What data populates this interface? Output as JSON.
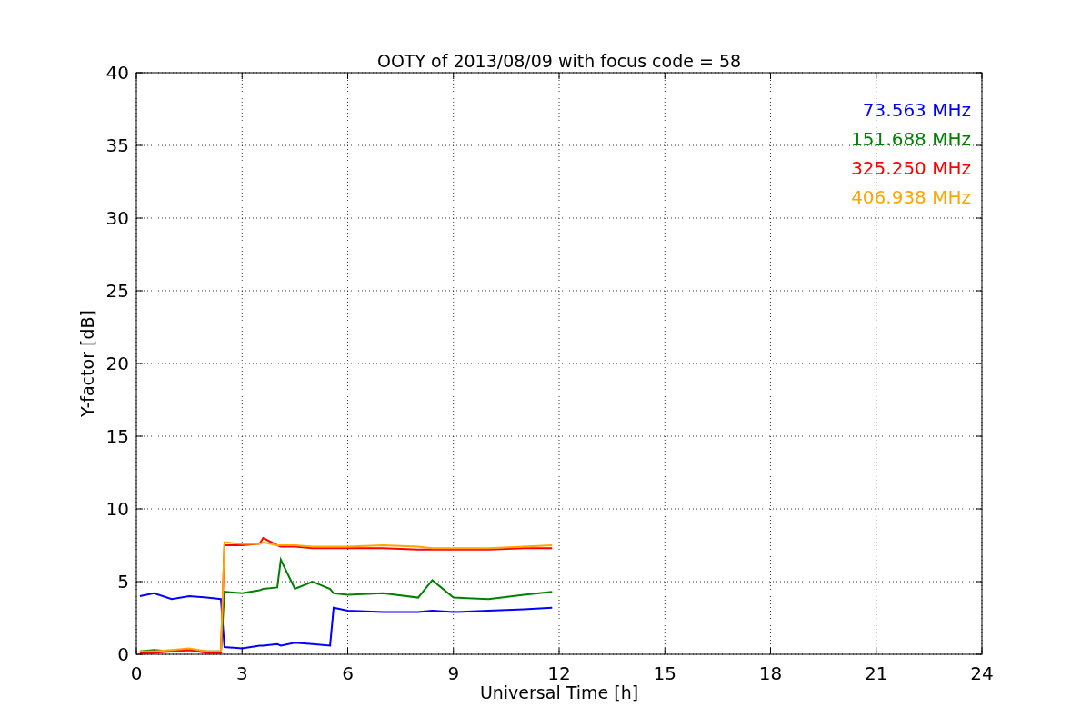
{
  "figure": {
    "chart_data": {
      "type": "line",
      "title": "OOTY of 2013/08/09 with focus code = 58",
      "xlabel": "Universal Time [h]",
      "ylabel": "Y-factor [dB]",
      "x": [
        0.1,
        0.5,
        1,
        1.5,
        2,
        2.4,
        2.5,
        3,
        3.5,
        3.6,
        4,
        4.1,
        4.5,
        5,
        5.5,
        5.6,
        6,
        7,
        8,
        8.4,
        9,
        10,
        11,
        11.8
      ],
      "series": [
        {
          "name": "73.563 MHz",
          "color": "#0000ff",
          "values": [
            4,
            4.2,
            3.8,
            4,
            3.9,
            3.8,
            0.5,
            0.4,
            0.6,
            0.6,
            0.7,
            0.6,
            0.8,
            0.7,
            0.6,
            3.2,
            3,
            2.9,
            2.9,
            3,
            2.9,
            3,
            3.1,
            3.2
          ]
        },
        {
          "name": "151.688 MHz",
          "color": "#008000",
          "values": [
            0.2,
            0.3,
            0.2,
            0.3,
            0.2,
            0.2,
            4.3,
            4.2,
            4.4,
            4.5,
            4.6,
            6.5,
            4.5,
            5,
            4.5,
            4.2,
            4.1,
            4.2,
            3.9,
            5.1,
            3.9,
            3.8,
            4.1,
            4.3
          ]
        },
        {
          "name": "325.250 MHz",
          "color": "#ff0000",
          "values": [
            0.1,
            0.1,
            0.2,
            0.3,
            0.1,
            0.1,
            7.5,
            7.5,
            7.6,
            8,
            7.5,
            7.4,
            7.4,
            7.3,
            7.3,
            7.3,
            7.3,
            7.3,
            7.2,
            7.2,
            7.2,
            7.2,
            7.3,
            7.3
          ]
        },
        {
          "name": "406.938 MHz",
          "color": "#ffa500",
          "values": [
            0.2,
            0.2,
            0.3,
            0.4,
            0.2,
            0.2,
            7.7,
            7.6,
            7.6,
            7.7,
            7.5,
            7.5,
            7.5,
            7.4,
            7.4,
            7.4,
            7.4,
            7.5,
            7.4,
            7.3,
            7.3,
            7.3,
            7.4,
            7.5
          ]
        }
      ],
      "grid": true,
      "xlim": [
        0,
        24
      ],
      "ylim": [
        0,
        40
      ],
      "xticks": [
        0,
        3,
        6,
        9,
        12,
        15,
        18,
        21,
        24
      ],
      "yticks": [
        0,
        5,
        10,
        15,
        20,
        25,
        30,
        35,
        40
      ]
    }
  }
}
